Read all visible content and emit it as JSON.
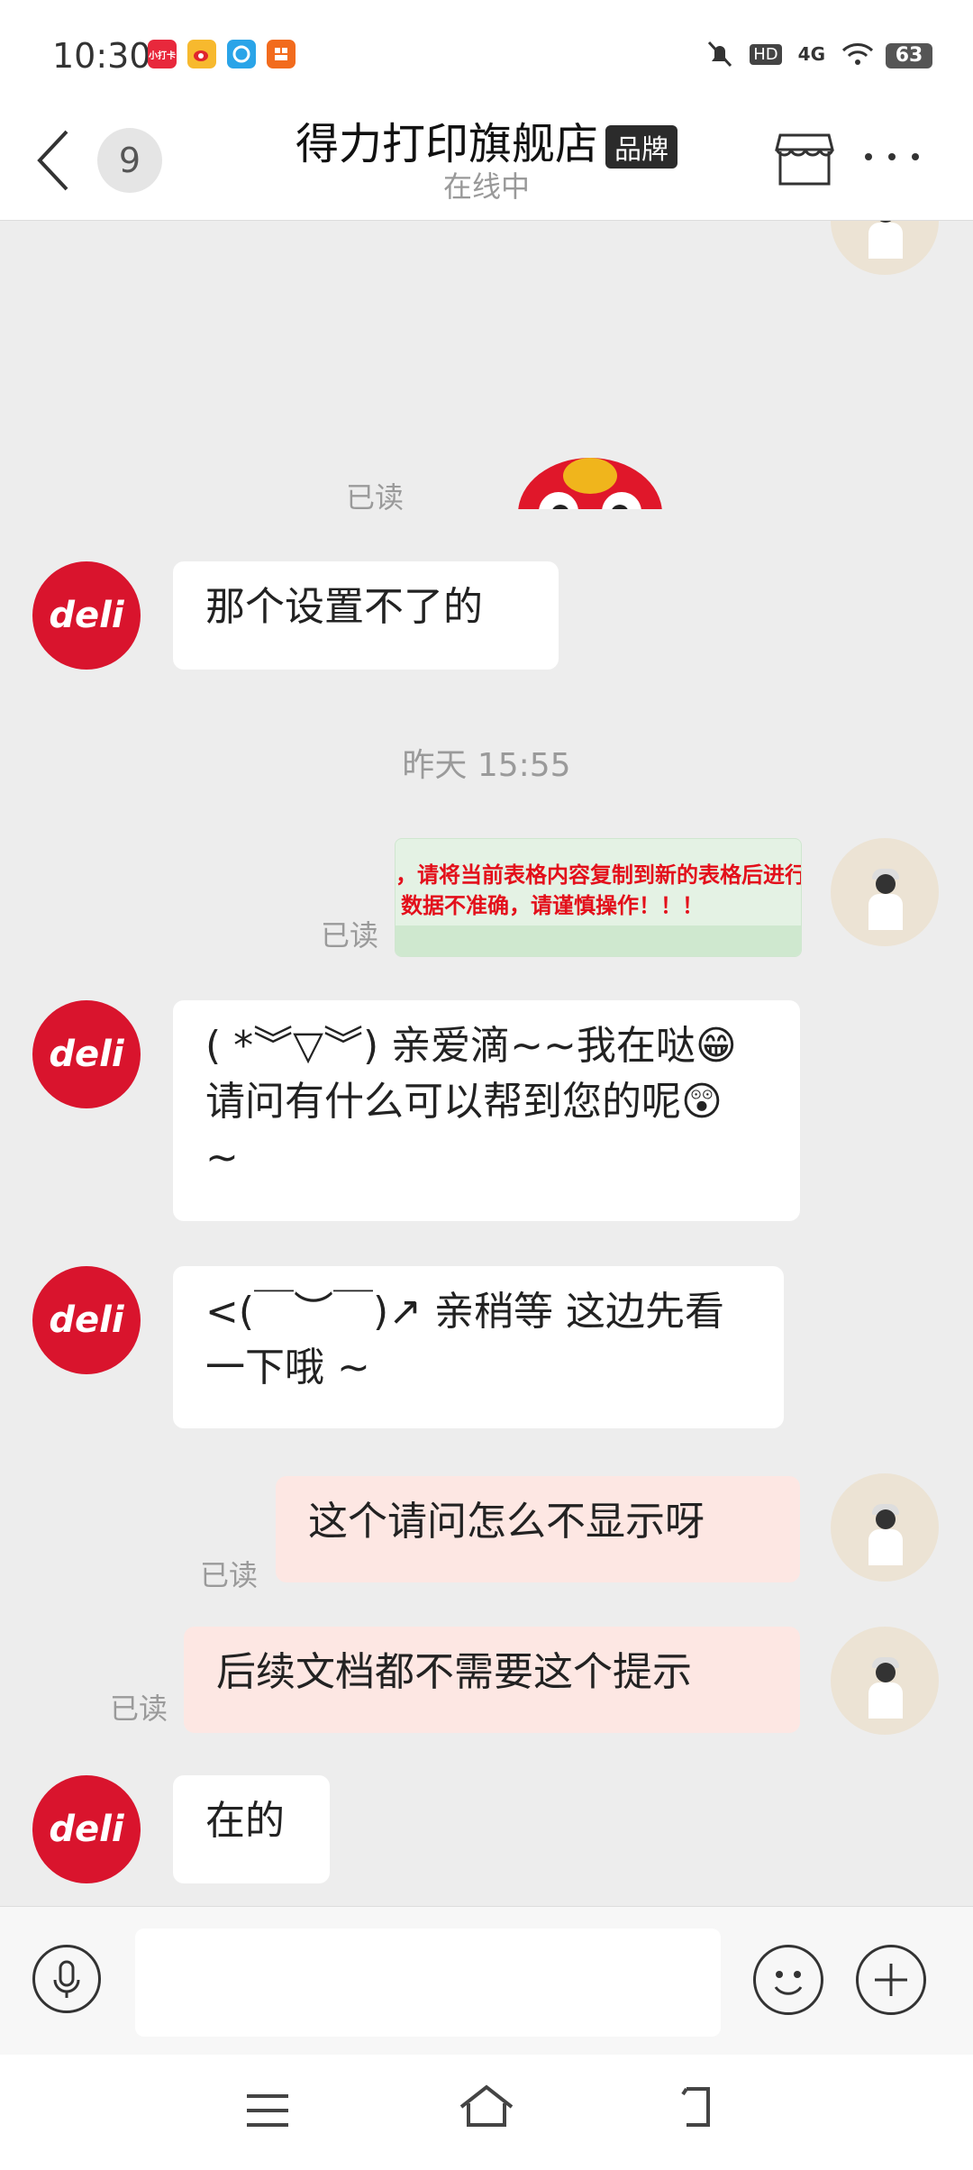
{
  "status_bar": {
    "time": "10:30",
    "app_icons": [
      {
        "name": "app-icon-1",
        "color": "#e8283c",
        "text": "小打卡"
      },
      {
        "name": "weibo-icon",
        "color": "#f7b92e",
        "text": ""
      },
      {
        "name": "app-icon-3",
        "color": "#2aa4e8",
        "text": ""
      },
      {
        "name": "app-icon-4",
        "color": "#f26b1d",
        "text": ""
      }
    ],
    "battery": "63",
    "network": "4G",
    "hd": "HD"
  },
  "header": {
    "unread_count": "9",
    "title": "得力打印旗舰店",
    "badge": "品牌",
    "subtitle": "在线中"
  },
  "messages": {
    "read_1": "已读",
    "m1_text": "那个设置不了的",
    "timestamp": "昨天 15:55",
    "image_line_1": "，请将当前表格内容复制到新的表格后进行",
    "image_line_2": "数据不准确，请谨慎操作！！！",
    "read_2": "已读",
    "m2_text": "( *︾▽︾) 亲爱滴~~我在哒😁请问有什么可以帮到您的呢😲 ~",
    "m3_text": "<(￣︶￣)↗ 亲稍等 这边先看一下哦 ~",
    "m4_text": "这个请问怎么不显示呀",
    "read_3": "已读",
    "m5_text": "后续文档都不需要这个提示",
    "read_4": "已读",
    "m6_text": "在的"
  },
  "deli_logo_text": "deli",
  "colors": {
    "accent_red": "#d9142d",
    "my_bubble": "#fde7e3",
    "chat_bg": "#ededed"
  }
}
